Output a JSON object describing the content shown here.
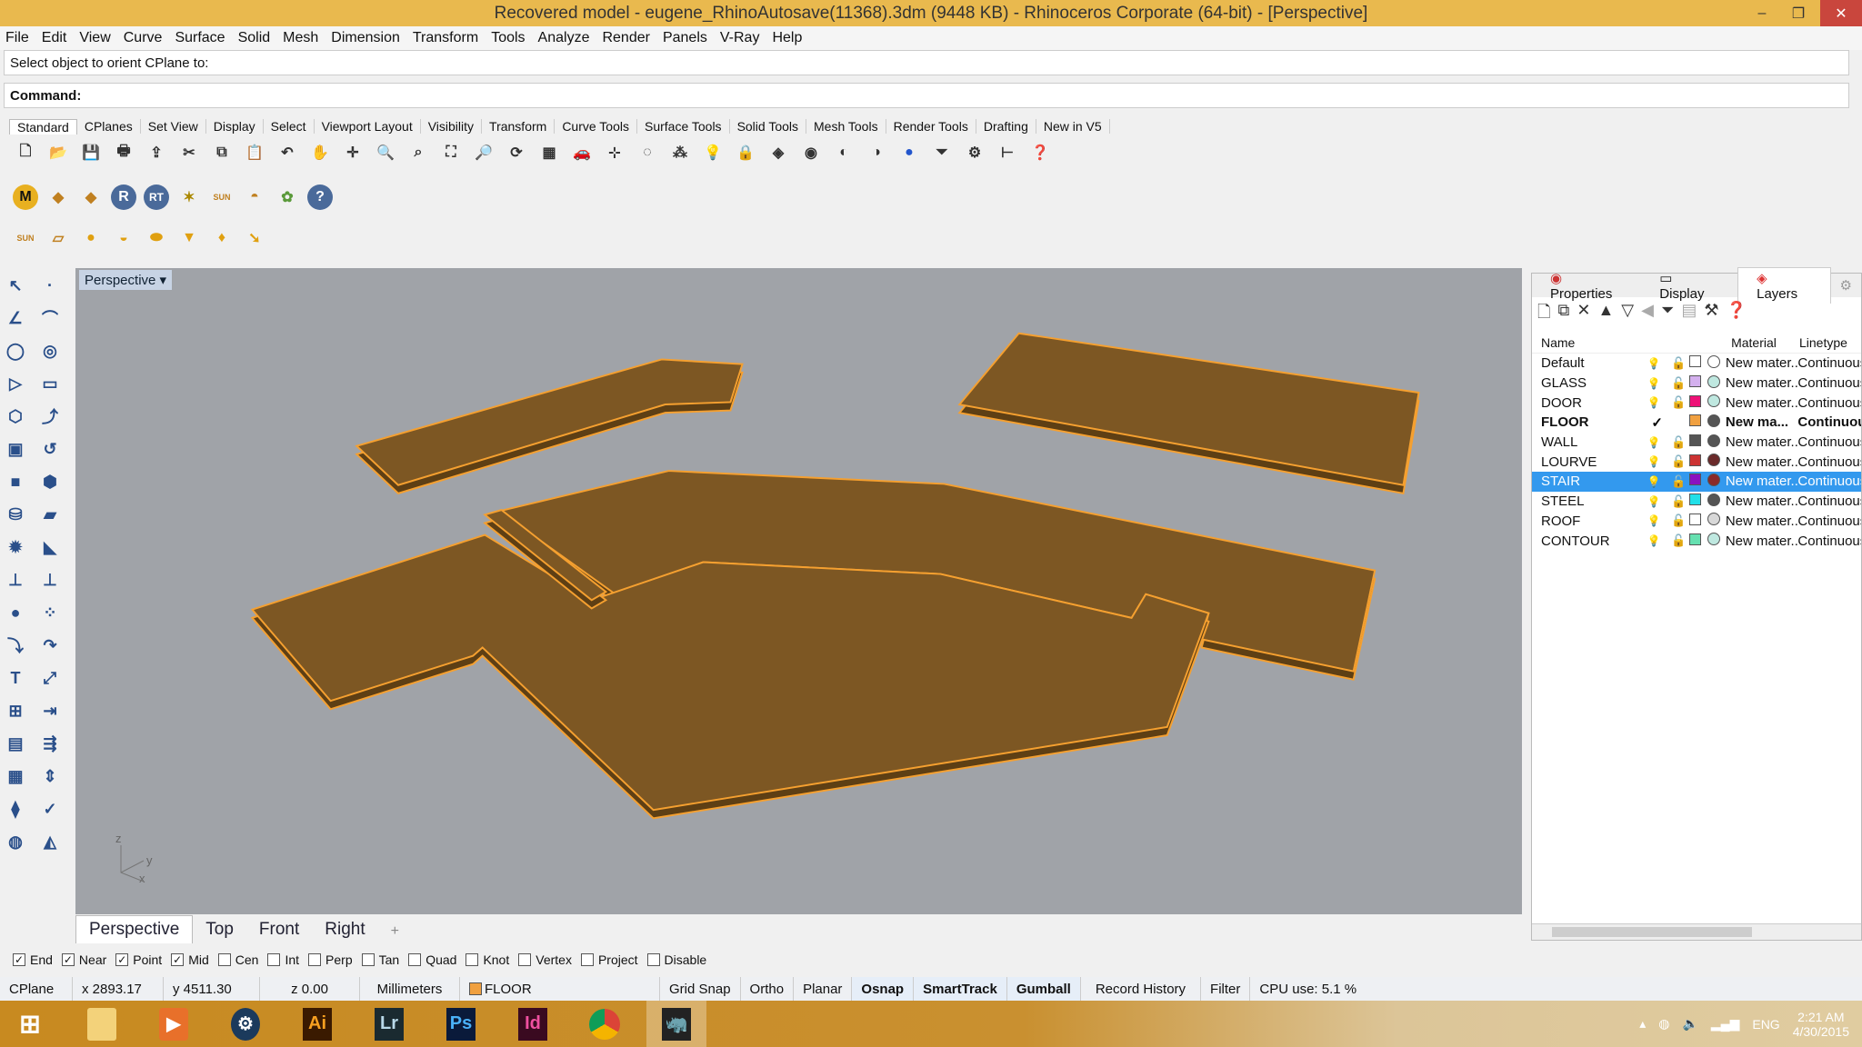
{
  "title": "Recovered model - eugene_RhinoAutosave(11368).3dm (9448 KB) - Rhinoceros Corporate (64-bit) - [Perspective]",
  "menu": [
    "File",
    "Edit",
    "View",
    "Curve",
    "Surface",
    "Solid",
    "Mesh",
    "Dimension",
    "Transform",
    "Tools",
    "Analyze",
    "Render",
    "Panels",
    "V-Ray",
    "Help"
  ],
  "command": {
    "history": "Select object to orient CPlane to:",
    "prompt": "Command:"
  },
  "toolbar_tabs": [
    "Standard",
    "CPlanes",
    "Set View",
    "Display",
    "Select",
    "Viewport Layout",
    "Visibility",
    "Transform",
    "Curve Tools",
    "Surface Tools",
    "Solid Tools",
    "Mesh Tools",
    "Render Tools",
    "Drafting",
    "New in V5"
  ],
  "vray_icons": {
    "m": "M",
    "r": "R",
    "rt": "RT",
    "sun": "SUN"
  },
  "viewport": {
    "label": "Perspective",
    "axes": {
      "z": "z",
      "y": "y",
      "x": "x"
    },
    "tabs": [
      "Perspective",
      "Top",
      "Front",
      "Right"
    ],
    "add": "+"
  },
  "panel": {
    "tabs": [
      "Properties",
      "Display",
      "Layers"
    ],
    "headers": {
      "name": "Name",
      "material": "Material",
      "linetype": "Linetype"
    },
    "layers": [
      {
        "name": "Default",
        "color": "#ffffff",
        "mat": "#ffffff",
        "material": "New mater...",
        "linetype": "Continuous"
      },
      {
        "name": "GLASS",
        "color": "#d4b0ee",
        "mat": "#bfe8e0",
        "material": "New mater...",
        "linetype": "Continuous"
      },
      {
        "name": "DOOR",
        "color": "#ee1177",
        "mat": "#bfe8e0",
        "material": "New mater...",
        "linetype": "Continuous"
      },
      {
        "name": "FLOOR",
        "color": "#f0a040",
        "mat": "#555555",
        "material": "New ma...",
        "linetype": "Continuous",
        "current": "✓"
      },
      {
        "name": "WALL",
        "color": "#555555",
        "mat": "#555555",
        "material": "New mater...",
        "linetype": "Continuous"
      },
      {
        "name": "LOURVE",
        "color": "#cc3333",
        "mat": "#6a2a2a",
        "material": "New mater...",
        "linetype": "Continuous"
      },
      {
        "name": "STAIR",
        "color": "#8a10c0",
        "mat": "#8a2a2a",
        "material": "New mater...",
        "linetype": "Continuous"
      },
      {
        "name": "STEEL",
        "color": "#22e0e8",
        "mat": "#555555",
        "material": "New mater...",
        "linetype": "Continuous"
      },
      {
        "name": "ROOF",
        "color": "#ffffff",
        "mat": "#d8d8d8",
        "material": "New mater...",
        "linetype": "Continuous"
      },
      {
        "name": "CONTOUR",
        "color": "#66e0b0",
        "mat": "#bfe8e0",
        "material": "New mater...",
        "linetype": "Continuous"
      }
    ]
  },
  "osnap": [
    {
      "label": "End",
      "checked": true
    },
    {
      "label": "Near",
      "checked": true
    },
    {
      "label": "Point",
      "checked": true
    },
    {
      "label": "Mid",
      "checked": true
    },
    {
      "label": "Cen",
      "checked": false
    },
    {
      "label": "Int",
      "checked": false
    },
    {
      "label": "Perp",
      "checked": false
    },
    {
      "label": "Tan",
      "checked": false
    },
    {
      "label": "Quad",
      "checked": false
    },
    {
      "label": "Knot",
      "checked": false
    },
    {
      "label": "Vertex",
      "checked": false
    },
    {
      "label": "Project",
      "checked": false
    },
    {
      "label": "Disable",
      "checked": false
    }
  ],
  "status": {
    "cplane": "CPlane",
    "x": "x 2893.17",
    "y": "y 4511.30",
    "z": "z 0.00",
    "units": "Millimeters",
    "layer": "FLOOR",
    "grid_snap": "Grid Snap",
    "ortho": "Ortho",
    "planar": "Planar",
    "osnap": "Osnap",
    "smarttrack": "SmartTrack",
    "gumball": "Gumball",
    "record_history": "Record History",
    "filter": "Filter",
    "cpu": "CPU use: 5.1 %"
  },
  "taskbar": {
    "apps": [
      "Ai",
      "Lr",
      "Ps",
      "Id"
    ],
    "lang": "ENG",
    "time": "2:21 AM",
    "date": "4/30/2015"
  },
  "colors": {
    "floor_fill": "#7d5723",
    "floor_edge": "#f5a030",
    "selected_row": "#3399ee"
  }
}
